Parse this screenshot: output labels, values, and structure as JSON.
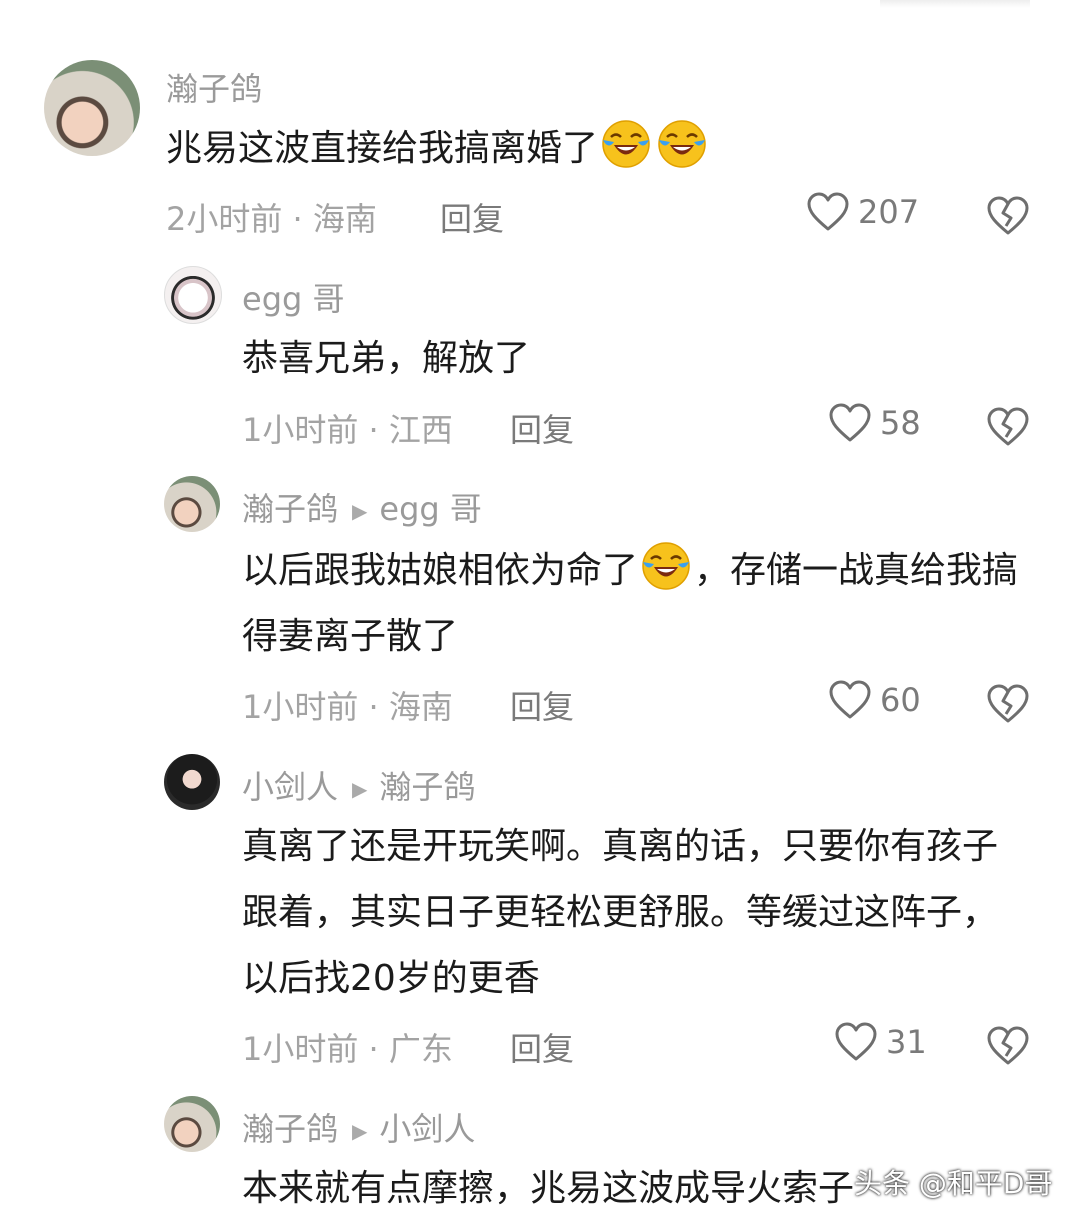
{
  "comments": [
    {
      "user": "瀚子鸽",
      "reply_to": "",
      "text": "兆易这波直接给我搞离婚了",
      "meta": "2小时前 · 海南",
      "reply_label": "回复",
      "likes": "207"
    },
    {
      "user": "egg 哥",
      "reply_to": "",
      "text": "恭喜兄弟，解放了",
      "meta": "1小时前 · 江西",
      "reply_label": "回复",
      "likes": "58"
    },
    {
      "user": "瀚子鸽",
      "reply_to": "egg 哥",
      "text_part1": "以后跟我姑娘相依为命了",
      "text_part2": "，存储一战真给我搞得妻离子散了",
      "meta": "1小时前 · 海南",
      "reply_label": "回复",
      "likes": "60"
    },
    {
      "user": "小剑人",
      "reply_to": "瀚子鸽",
      "text": "真离了还是开玩笑啊。真离的话，只要你有孩子跟着，其实日子更轻松更舒服。等缓过这阵子，以后找20岁的更香",
      "meta": "1小时前 · 广东",
      "reply_label": "回复",
      "likes": "31"
    },
    {
      "user": "瀚子鸽",
      "reply_to": "小剑人",
      "text": "本来就有点摩擦，兆易这波成导火索子"
    }
  ],
  "watermark": "头条 @和平D哥",
  "icons": {
    "like": "heart-outline-icon",
    "dislike": "broken-heart-icon",
    "reply_arrow": "triangle-right-icon",
    "emoji": "crying-laughing-emoji"
  },
  "colors": {
    "name": "#9a9a9a",
    "text": "#1b1b1b",
    "meta": "#a3a3a3"
  }
}
